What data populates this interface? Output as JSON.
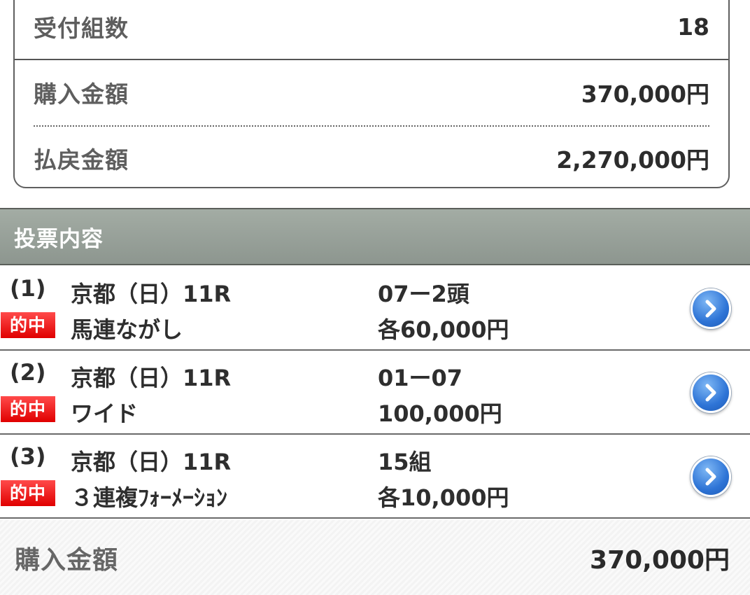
{
  "summary": {
    "accepted_count_label": "受付組数",
    "accepted_count_value": "18",
    "purchase_amount_label": "購入金額",
    "purchase_amount_value": "370,000円",
    "payout_amount_label": "払戻金額",
    "payout_amount_value": "2,270,000円"
  },
  "bets_section": {
    "title": "投票内容",
    "items": [
      {
        "index": "(1)",
        "badge": "的中",
        "race": "京都（日）11R",
        "type": "馬連ながし",
        "combo": "07ー2頭",
        "amount": "各60,000円"
      },
      {
        "index": "(2)",
        "badge": "的中",
        "race": "京都（日）11R",
        "type": "ワイド",
        "combo": "01ー07",
        "amount": "100,000円"
      },
      {
        "index": "(3)",
        "badge": "的中",
        "race": "京都（日）11R",
        "type": "３連複ﾌｫｰﾒｰｼｮﾝ",
        "combo": "15組",
        "amount": "各10,000円"
      }
    ]
  },
  "total": {
    "label": "購入金額",
    "value": "370,000円"
  },
  "icons": {
    "detail_button": "chevron-right-icon"
  },
  "colors": {
    "header_bg": "#939c95",
    "hit_badge": "#e60000",
    "detail_button": "#2e74d6"
  }
}
